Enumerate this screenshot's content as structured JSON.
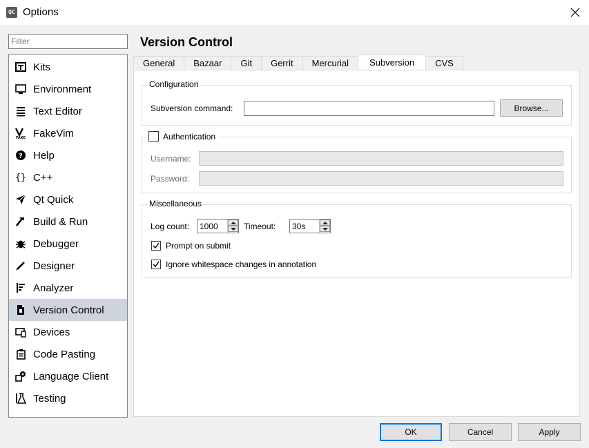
{
  "window": {
    "title": "Options",
    "app_icon_text": "QC"
  },
  "filter": {
    "placeholder": "Filter"
  },
  "sidebar": {
    "items": [
      {
        "label": "Kits",
        "icon": "kits-icon"
      },
      {
        "label": "Environment",
        "icon": "monitor-icon"
      },
      {
        "label": "Text Editor",
        "icon": "text-editor-icon"
      },
      {
        "label": "FakeVim",
        "icon": "fakevim-icon"
      },
      {
        "label": "Help",
        "icon": "help-icon"
      },
      {
        "label": "C++",
        "icon": "braces-icon"
      },
      {
        "label": "Qt Quick",
        "icon": "qt-quick-icon"
      },
      {
        "label": "Build & Run",
        "icon": "hammer-icon"
      },
      {
        "label": "Debugger",
        "icon": "bug-icon"
      },
      {
        "label": "Designer",
        "icon": "pencil-icon"
      },
      {
        "label": "Analyzer",
        "icon": "analyzer-icon"
      },
      {
        "label": "Version Control",
        "icon": "version-control-icon",
        "selected": true
      },
      {
        "label": "Devices",
        "icon": "devices-icon"
      },
      {
        "label": "Code Pasting",
        "icon": "clipboard-icon"
      },
      {
        "label": "Language Client",
        "icon": "language-client-icon"
      },
      {
        "label": "Testing",
        "icon": "flask-icon"
      }
    ]
  },
  "page": {
    "title": "Version Control"
  },
  "tabs": [
    {
      "label": "General"
    },
    {
      "label": "Bazaar"
    },
    {
      "label": "Git"
    },
    {
      "label": "Gerrit"
    },
    {
      "label": "Mercurial"
    },
    {
      "label": "Subversion",
      "active": true
    },
    {
      "label": "CVS"
    }
  ],
  "configuration": {
    "title": "Configuration",
    "command_label": "Subversion command:",
    "command_value": "",
    "browse_label": "Browse..."
  },
  "authentication": {
    "title": "Authentication",
    "checked": false,
    "username_label": "Username:",
    "username_value": "",
    "password_label": "Password:",
    "password_value": ""
  },
  "miscellaneous": {
    "title": "Miscellaneous",
    "log_count_label": "Log count:",
    "log_count_value": "1000",
    "timeout_label": "Timeout:",
    "timeout_value": "30s",
    "prompt_label": "Prompt on submit",
    "prompt_checked": true,
    "ignore_ws_label": "Ignore whitespace changes in annotation",
    "ignore_ws_checked": true
  },
  "footer": {
    "ok_label": "OK",
    "cancel_label": "Cancel",
    "apply_label": "Apply"
  },
  "colors": {
    "selection": "#cdd4dc",
    "default_button_border": "#0078d7",
    "disabled_field": "#e8e8e8"
  }
}
